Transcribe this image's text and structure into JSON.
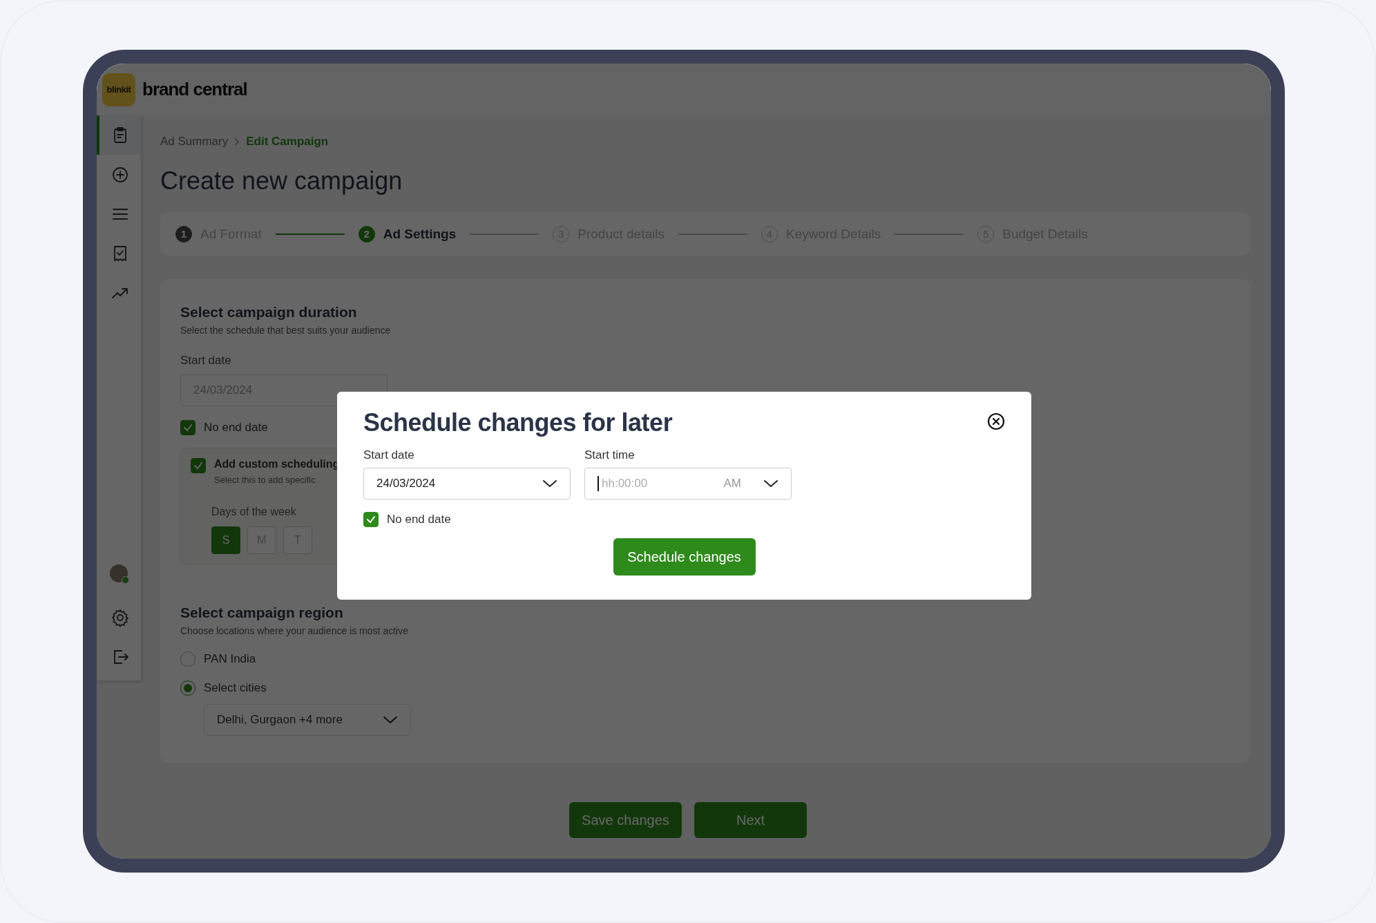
{
  "header": {
    "logo": "blinkit",
    "title": "brand central"
  },
  "sidebar": {
    "items": [
      {
        "selected": true
      },
      {
        "selected": false
      },
      {
        "selected": false
      },
      {
        "selected": false
      },
      {
        "selected": false
      }
    ],
    "user": {
      "online": true
    }
  },
  "breadcrumb": [
    {
      "label": "Ad Summary",
      "selected": false
    },
    {
      "label": "Edit Campaign",
      "selected": true
    }
  ],
  "page_title": "Create new campaign",
  "steps": [
    {
      "number": "1",
      "label": "Ad Format",
      "done": true,
      "selected": false
    },
    {
      "number": "2",
      "label": "Ad Settings",
      "done": false,
      "selected": true
    },
    {
      "number": "3",
      "label": "Product details",
      "done": false,
      "selected": false
    },
    {
      "number": "4",
      "label": "Keyword Details",
      "done": false,
      "selected": false
    },
    {
      "number": "5",
      "label": "Budget Details",
      "done": false,
      "selected": false
    }
  ],
  "duration": {
    "title": "Select campaign duration",
    "subtitle": "Select the schedule that best suits your audience",
    "start_date_label": "Start date",
    "start_date": "24/03/2024",
    "no_end_date": {
      "label": "No end date",
      "checked": true
    },
    "custom_scheduling": {
      "label": "Add custom scheduling",
      "sublabel": "Select this to add specific",
      "checked": true,
      "days_label": "Days of the week",
      "days": [
        {
          "label": "S",
          "selected": true
        },
        {
          "label": "M",
          "selected": false
        },
        {
          "label": "T",
          "selected": false
        }
      ]
    }
  },
  "region": {
    "title": "Select campaign region",
    "subtitle": "Choose locations where your audience is most active",
    "options": [
      {
        "label": "PAN India",
        "selected": false
      },
      {
        "label": "Select cities",
        "selected": true
      }
    ],
    "cities": "Delhi, Gurgaon +4 more"
  },
  "footer_buttons": [
    "Save changes",
    "Next"
  ],
  "modal": {
    "title": "Schedule changes for later",
    "start_date": {
      "label": "Start date",
      "value": "24/03/2024"
    },
    "start_time": {
      "label": "Start time",
      "placeholder": "hh:00:00",
      "period": "AM"
    },
    "no_end_date": {
      "label": "No end date",
      "checked": true
    },
    "button": "Schedule changes"
  }
}
